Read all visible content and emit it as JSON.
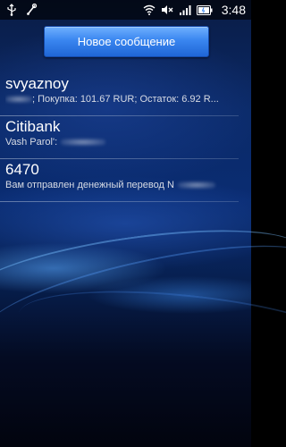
{
  "statusbar": {
    "left_icons": [
      "usb-icon",
      "debug-icon"
    ],
    "right_icons": [
      "wifi-icon",
      "mute-icon",
      "signal-icon",
      "battery-icon"
    ],
    "time": "3:48"
  },
  "toolbar": {
    "new_message_label": "Новое сообщение"
  },
  "threads": [
    {
      "name": "svyaznoy",
      "preview": "; Покупка: 101.67 RUR; Остаток: 6.92 R..."
    },
    {
      "name": "Citibank",
      "preview": "Vash Parol':"
    },
    {
      "name": "6470",
      "preview": "Вам отправлен денежный перевод N"
    }
  ],
  "colors": {
    "button_accent": "#3a86f0",
    "background_top": "#0b2a68",
    "background_bottom": "#02040e"
  }
}
